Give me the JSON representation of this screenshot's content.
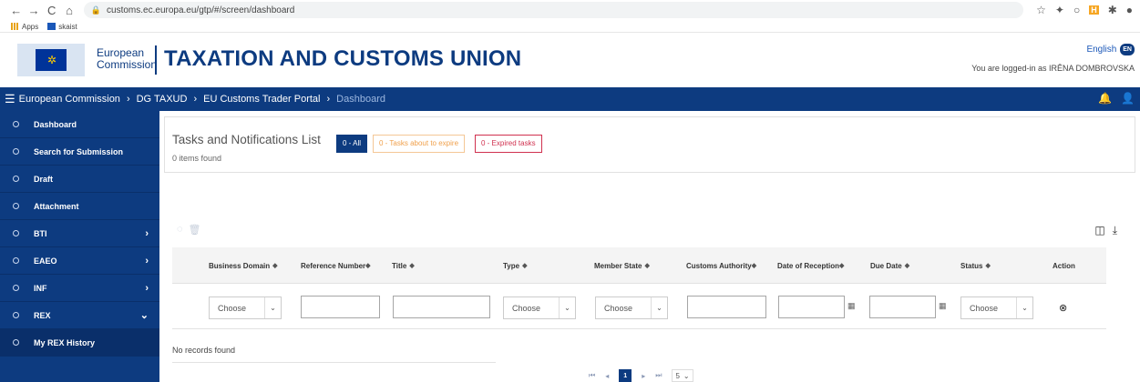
{
  "browser": {
    "back": "←",
    "forward": "→",
    "reload": "C",
    "home": "⌂",
    "url": "customs.ec.europa.eu/gtp/#/screen/dashboard",
    "bookmarks": [
      "Apps",
      "skaist"
    ]
  },
  "site": {
    "ec_line1": "European",
    "ec_line2": "Commission",
    "title": "TAXATION AND CUSTOMS UNION",
    "language": "English",
    "language_code": "EN",
    "logged_in": "You are logged-in as IRĒNA DOMBROVSKA"
  },
  "breadcrumb": [
    "European Commission",
    "DG TAXUD",
    "EU Customs Trader Portal",
    "Dashboard"
  ],
  "sidebar": {
    "items": [
      {
        "label": "Dashboard"
      },
      {
        "label": "Search for Submission"
      },
      {
        "label": "Draft"
      },
      {
        "label": "Attachment"
      },
      {
        "label": "BTI"
      },
      {
        "label": "EAEO"
      },
      {
        "label": "INF"
      },
      {
        "label": "REX"
      },
      {
        "label": "My REX History"
      }
    ]
  },
  "tasks": {
    "title": "Tasks and Notifications List",
    "count": "0 items found",
    "filters": {
      "all": "0 - All",
      "about_to_expire": "0 - Tasks about to expire",
      "expired": "0 - Expired tasks"
    }
  },
  "table": {
    "columns": [
      "Business Domain",
      "Reference Number",
      "Title",
      "Type",
      "Member State",
      "Customs Authority",
      "Date of Reception",
      "Due Date",
      "Status",
      "Action"
    ],
    "choose": "Choose",
    "no_records": "No records found"
  },
  "pager": {
    "current_page": "1",
    "page_size": "5"
  },
  "colors": {
    "primary": "#0d3b80",
    "warning": "#f0a04b",
    "danger": "#d0314f"
  }
}
